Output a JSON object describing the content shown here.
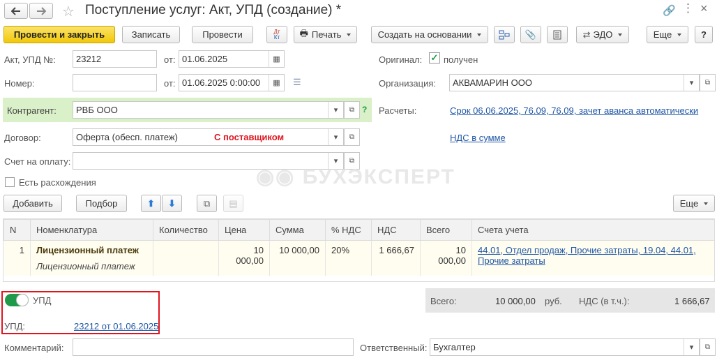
{
  "window": {
    "title": "Поступление услуг: Акт, УПД (создание) *"
  },
  "toolbar": {
    "post_close": "Провести и закрыть",
    "save": "Записать",
    "post": "Провести",
    "dt_kt": "Дт Кт",
    "print": "Печать",
    "create_based": "Создать на основании",
    "edo": "ЭДО",
    "more": "Еще",
    "help": "?"
  },
  "form": {
    "act_label": "Акт, УПД №:",
    "act_number": "23212",
    "from_label": "от:",
    "act_date": "01.06.2025",
    "number_label": "Номер:",
    "number_value": "",
    "from2_label": "от:",
    "number_date": "01.06.2025  0:00:00",
    "original_label": "Оригинал:",
    "original_value": "получен",
    "org_label": "Организация:",
    "org_value": "АКВАМАРИН ООО",
    "contractor_label": "Контрагент:",
    "contractor_value": "РВБ ООО",
    "settlements_label": "Расчеты:",
    "settlements_link": "Срок 06.06.2025, 76.09, 76.09, зачет аванса автоматически",
    "contract_label": "Договор:",
    "contract_value": "Оферта (обесп. платеж)",
    "contract_type": "С поставщиком",
    "vat_link": "НДС в сумме",
    "invoice_label": "Счет на оплату:",
    "invoice_value": "",
    "discrepancy_label": "Есть расхождения"
  },
  "table_toolbar": {
    "add": "Добавить",
    "pick": "Подбор",
    "more": "Еще"
  },
  "table": {
    "columns": [
      "N",
      "Номенклатура",
      "Количество",
      "Цена",
      "Сумма",
      "% НДС",
      "НДС",
      "Всего",
      "Счета учета"
    ],
    "rows": [
      {
        "n": "1",
        "item": "Лицензионный платеж",
        "item_sub": "Лицензионный платеж",
        "qty": "",
        "price": "10 000,00",
        "sum": "10 000,00",
        "vat_rate": "20%",
        "vat": "1 666,67",
        "total": "10 000,00",
        "accounts_line1": "44.01, Отдел продаж, Прочие затраты, 19.04, 44.01,",
        "accounts_line2": "Прочие затраты"
      }
    ]
  },
  "upd": {
    "toggle_label": "УПД",
    "upd_label": "УПД:",
    "upd_link": "23212 от 01.06.2025"
  },
  "totals": {
    "total_label": "Всего:",
    "total_value": "10 000,00",
    "currency": "руб.",
    "vat_label": "НДС (в т.ч.):",
    "vat_value": "1 666,67"
  },
  "footer": {
    "comment_label": "Комментарий:",
    "comment_value": "",
    "responsible_label": "Ответственный:",
    "responsible_value": "Бухгалтер"
  },
  "watermark": "БУХЭКСПЕРТ",
  "colors": {
    "accent_yellow": "#f2c808",
    "contractor_bg": "#d9f0c8",
    "link": "#1f57a6",
    "highlight_red": "#e0141e",
    "toggle_green": "#1e9a4a"
  }
}
